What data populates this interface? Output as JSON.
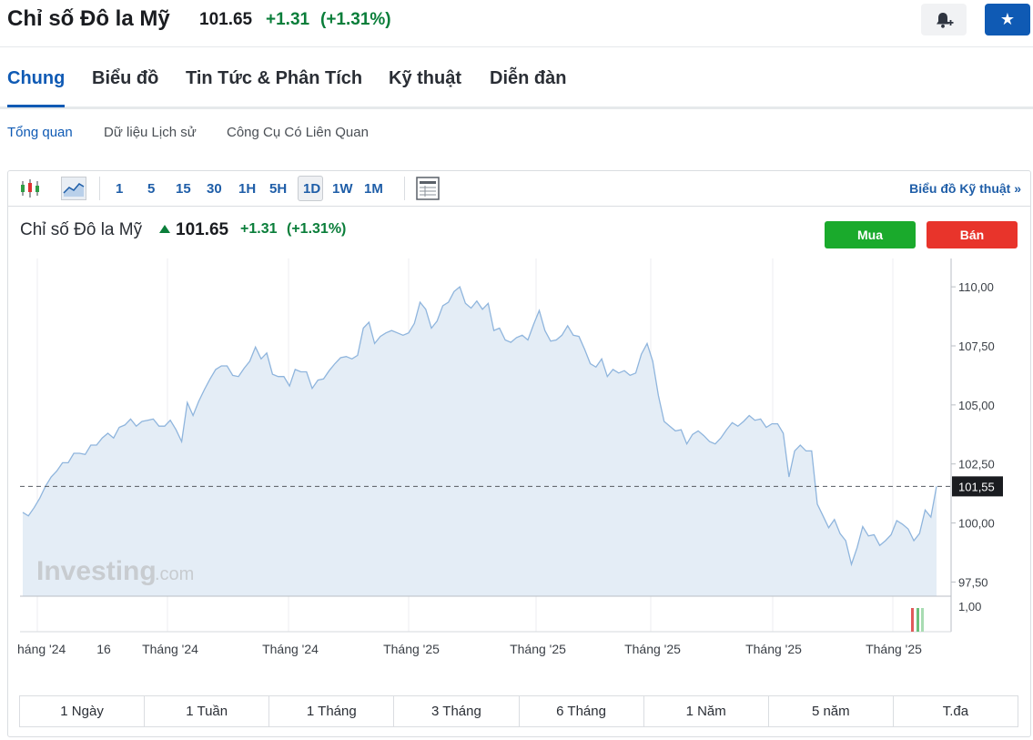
{
  "header": {
    "title": "Chỉ số Đô la Mỹ",
    "price": "101.65",
    "change": "+1.31",
    "change_pct": "(+1.31%)"
  },
  "tabs": [
    "Chung",
    "Biểu đồ",
    "Tin Tức & Phân Tích",
    "Kỹ thuật",
    "Diễn đàn"
  ],
  "subtabs": [
    "Tổng quan",
    "Dữ liệu Lịch sử",
    "Công Cụ Có Liên Quan"
  ],
  "toolbar": {
    "intervals": [
      "1",
      "5",
      "15",
      "30",
      "1H",
      "5H",
      "1D",
      "1W",
      "1M"
    ],
    "selected_interval": "1D",
    "tech_link": "Biểu đồ Kỹ thuật »"
  },
  "instrument": {
    "name": "Chỉ số Đô la Mỹ",
    "price": "101.65",
    "change": "+1.31",
    "change_pct": "(+1.31%)",
    "buy_label": "Mua",
    "sell_label": "Bán"
  },
  "colors": {
    "accent": "#0f5ab4",
    "positive": "#0a7e3a",
    "buy": "#1aaa2c",
    "sell": "#e8342b",
    "line": "#8fb5dd",
    "area": "#e4edf6"
  },
  "chart_data": {
    "type": "area",
    "y_ticks": [
      "110,00",
      "107,50",
      "105,00",
      "102,50",
      "100,00",
      "97,50"
    ],
    "ylim": [
      96.9,
      111.2
    ],
    "last_value_label": "101,55",
    "last_value": 101.55,
    "volume_tick": "1,00",
    "x_tick_labels": [
      "háng '24",
      "16",
      "Tháng '24",
      "Tháng '24",
      "Tháng '25",
      "Tháng '25",
      "Tháng '25",
      "Tháng '25",
      "Tháng '25"
    ],
    "watermark": "Investing",
    "watermark_suffix": ".com",
    "values": [
      100.45,
      100.3,
      100.65,
      101.05,
      101.55,
      101.95,
      102.2,
      102.55,
      102.55,
      102.95,
      102.95,
      102.9,
      103.3,
      103.3,
      103.6,
      103.8,
      103.6,
      104.05,
      104.15,
      104.4,
      104.1,
      104.3,
      104.35,
      104.4,
      104.1,
      104.1,
      104.35,
      103.95,
      103.45,
      105.1,
      104.55,
      105.15,
      105.65,
      106.1,
      106.5,
      106.65,
      106.65,
      106.25,
      106.2,
      106.55,
      106.85,
      107.45,
      106.95,
      107.2,
      106.3,
      106.2,
      106.2,
      105.8,
      106.5,
      106.4,
      106.4,
      105.7,
      106.05,
      106.1,
      106.45,
      106.75,
      107.0,
      107.05,
      106.95,
      107.1,
      108.25,
      108.5,
      107.6,
      107.9,
      108.05,
      108.15,
      108.05,
      107.95,
      108.05,
      108.45,
      109.35,
      109.05,
      108.25,
      108.55,
      109.2,
      109.35,
      109.8,
      110.0,
      109.3,
      109.1,
      109.4,
      109.05,
      109.3,
      108.15,
      108.25,
      107.75,
      107.65,
      107.85,
      107.95,
      107.75,
      108.4,
      109.0,
      108.15,
      107.7,
      107.75,
      107.95,
      108.35,
      107.95,
      107.9,
      107.35,
      106.75,
      106.6,
      106.95,
      106.2,
      106.5,
      106.35,
      106.45,
      106.25,
      106.35,
      107.15,
      107.6,
      106.85,
      105.4,
      104.3,
      104.1,
      103.9,
      103.95,
      103.35,
      103.75,
      103.9,
      103.7,
      103.45,
      103.35,
      103.6,
      103.95,
      104.25,
      104.1,
      104.3,
      104.55,
      104.35,
      104.4,
      104.05,
      104.2,
      104.2,
      103.8,
      101.95,
      103.05,
      103.3,
      103.05,
      103.05,
      100.8,
      100.3,
      99.8,
      100.15,
      99.55,
      99.25,
      98.25,
      98.95,
      99.85,
      99.45,
      99.5,
      99.05,
      99.25,
      99.5,
      100.1,
      99.95,
      99.75,
      99.25,
      99.55,
      100.55,
      100.25,
      101.55
    ]
  },
  "periods": [
    "1 Ngày",
    "1 Tuần",
    "1 Tháng",
    "3 Tháng",
    "6 Tháng",
    "1 Năm",
    "5 năm",
    "T.đa"
  ]
}
